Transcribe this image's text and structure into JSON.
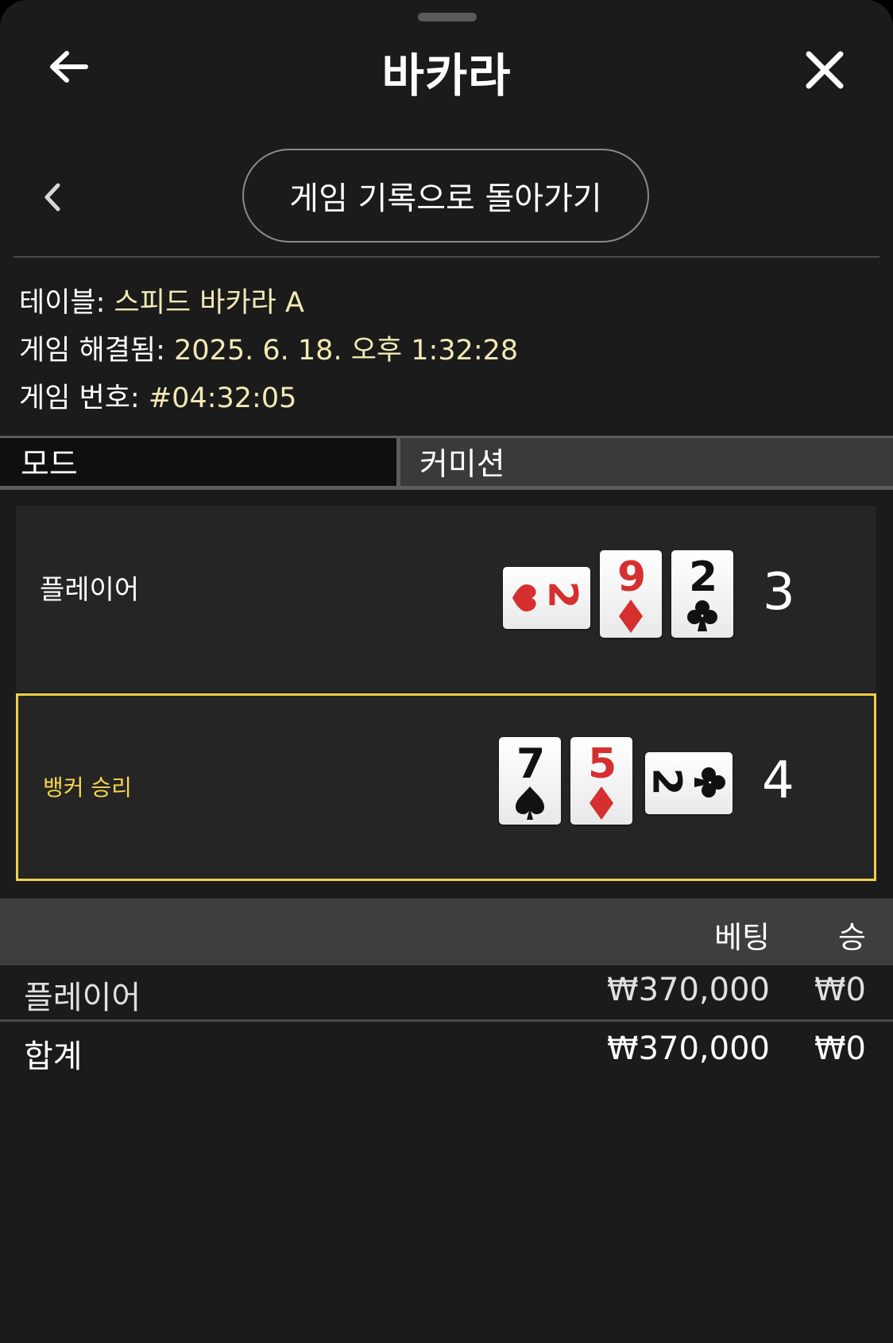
{
  "header": {
    "title": "바카라"
  },
  "nav": {
    "back_to_history_label": "게임 기록으로 돌아가기"
  },
  "info": {
    "table_label": "테이블:",
    "table_value": "스피드 바카라 A",
    "resolved_label": "게임 해결됨:",
    "resolved_value": "2025. 6. 18. 오후 1:32:28",
    "game_no_label": "게임 번호:",
    "game_no_value": "#04:32:05"
  },
  "tabs": [
    {
      "label": "모드"
    },
    {
      "label": "커미션"
    }
  ],
  "hands": {
    "player": {
      "label": "플레이어",
      "score": "3",
      "cards": [
        {
          "rank": "2",
          "suit": "hearts",
          "color": "#d62f2f",
          "orientation": "sideways"
        },
        {
          "rank": "9",
          "suit": "diamonds",
          "color": "#d62f2f"
        },
        {
          "rank": "2",
          "suit": "clubs",
          "color": "#111111"
        }
      ]
    },
    "banker": {
      "label": "뱅커 승리",
      "score": "4",
      "highlight_color": "#f0d04a",
      "cards": [
        {
          "rank": "7",
          "suit": "spades",
          "color": "#111111"
        },
        {
          "rank": "5",
          "suit": "diamonds",
          "color": "#d62f2f"
        },
        {
          "rank": "2",
          "suit": "clubs",
          "color": "#111111",
          "orientation": "sideways"
        }
      ]
    }
  },
  "bets": {
    "columns": {
      "bet": "베팅",
      "win": "승"
    },
    "rows": [
      {
        "name": "플레이어",
        "bet": "₩370,000",
        "win": "₩0"
      }
    ],
    "total": {
      "name": "합계",
      "bet": "₩370,000",
      "win": "₩0"
    }
  }
}
